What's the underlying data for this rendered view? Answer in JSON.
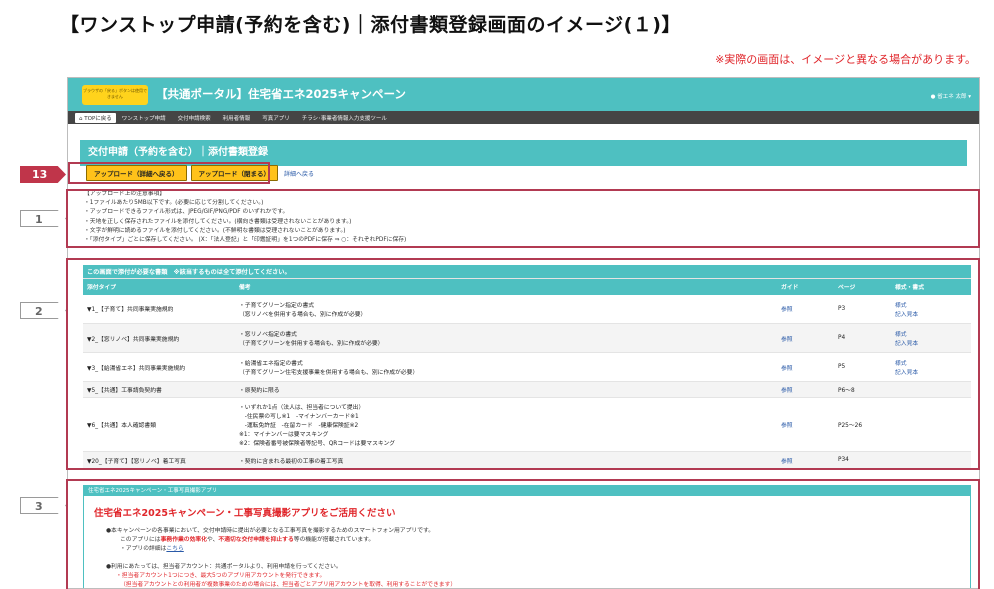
{
  "slide_title": "【ワンストップ申請(予約を含む)｜添付書類登録画面のイメージ(１)】",
  "disclaimer": "※実際の画面は、イメージと異なる場合があります。",
  "header": {
    "warn_badge": "ブラウザの「戻る」ボタンは使用できません",
    "portal_title": "【共通ポータル】住宅省エネ2025キャンペーン",
    "user": "省エネ 太郎"
  },
  "nav": [
    "TOPに戻る",
    "ワンストップ申請",
    "交付申請検索",
    "利用者情報",
    "写真アプリ",
    "チラシ･事業者情報入力支援ツール"
  ],
  "page_title": "交付申請（予約を含む）｜添付書類登録",
  "buttons": {
    "upload_detail": "アップロード（詳細へ戻る）",
    "upload_close": "アップロード（閉まる）",
    "back_link": "詳細へ戻る"
  },
  "notes": [
    "【アップロード上の注意事項】",
    "・1ファイルあたり5MB以下です。(必要に応じて分割してください。)",
    "・アップロードできるファイル形式は、JPEG/GIF/PNG/PDF のいずれかです。",
    "・天地を正しく保存されたファイルを添付してください。(横向き書類は受理されないことがあります。)",
    "・文字が鮮明に読めるファイルを添付してください。(不鮮明な書類は受理されないことがあります。)",
    "・「添付タイプ」ごとに保存してください。 (X：「法人登記」と「印鑑証明」を1つのPDFに保存 ⇒ ○：それぞれPDFに保存)"
  ],
  "table": {
    "caption": "この画面で添付が必要な書類　※該当するものは全て添付してください。",
    "headers": [
      "添付タイプ",
      "備考",
      "ガイド",
      "ページ",
      "様式・書式"
    ],
    "rows": [
      {
        "type": "▼1_【子育て】共同事業実施規約",
        "note": [
          "・子育てグリーン指定の書式",
          "（窓リノベを併用する場合も、別に作成が必要）"
        ],
        "guide": "参照",
        "page": "P3",
        "forms": [
          "様式",
          "記入見本"
        ]
      },
      {
        "type": "▼2_【窓リノベ】共同事業実施規約",
        "note": [
          "・窓リノベ指定の書式",
          "（子育てグリーンを併用する場合も、別に作成が必要）"
        ],
        "guide": "参照",
        "page": "P4",
        "forms": [
          "様式",
          "記入見本"
        ]
      },
      {
        "type": "▼3_【給湯省エネ】共同事業実施規約",
        "note": [
          "・給湯省エネ指定の書式",
          "（子育てグリーン住宅支援事業を併用する場合も、別に作成が必要）"
        ],
        "guide": "参照",
        "page": "P5",
        "forms": [
          "様式",
          "記入見本"
        ]
      },
      {
        "type": "▼5_【共通】工事請負契約書",
        "note": [
          "・原契約に限る"
        ],
        "guide": "参照",
        "page": "P6～8",
        "forms": []
      },
      {
        "type": "▼6_【共通】本人確認書類",
        "note": [
          "・いずれか1点（法人は、担当者について提出）",
          "　-住民票の写し※1　-マイナンバーカード※1",
          "　-運転免許証　-在留カード　-健康保険証※2",
          "※1：マイナンバーは要マスキング",
          "※2：保険者番号被保険者等記号、QRコードは要マスキング"
        ],
        "guide": "参照",
        "page": "P25～26",
        "forms": []
      },
      {
        "type": "▼20_【子育て】【窓リノベ】着工写真",
        "note": [
          "・契約に含まれる最初の工事の着工写真"
        ],
        "guide": "参照",
        "page": "P34",
        "forms": []
      }
    ]
  },
  "app_box": {
    "caption": "住宅省エネ2025キャンペーン・工事写真撮影アプリ",
    "title": "住宅省エネ2025キャンペーン・工事写真撮影アプリをご活用ください",
    "p1": "●本キャンペーンの各事業において、交付申請時に提出が必要となる工事写真を撮影するためのスマートフォン用アプリです。",
    "p2_a": "このアプリには",
    "p2_b": "事務作業の効率化",
    "p2_c": "や、",
    "p2_d": "不適切な交付申請を抑止する",
    "p2_e": "等の機能が搭載されています。",
    "p3_a": "・アプリの詳細は",
    "p3_link": "こちら",
    "p4": "●利用にあたっては、担当者アカウント：共通ポータルより、利用申請を行ってください。",
    "p5": "・担当者アカウント1つにつき、最大5つのアプリ用アカウントを発行できます。",
    "p6": "（担当者アカウントとの利用者が複数事業のための場合には、担当者ごとアプリ用アカウントを取得、利用することができます）"
  },
  "callouts": [
    "13",
    "1",
    "2",
    "3"
  ]
}
